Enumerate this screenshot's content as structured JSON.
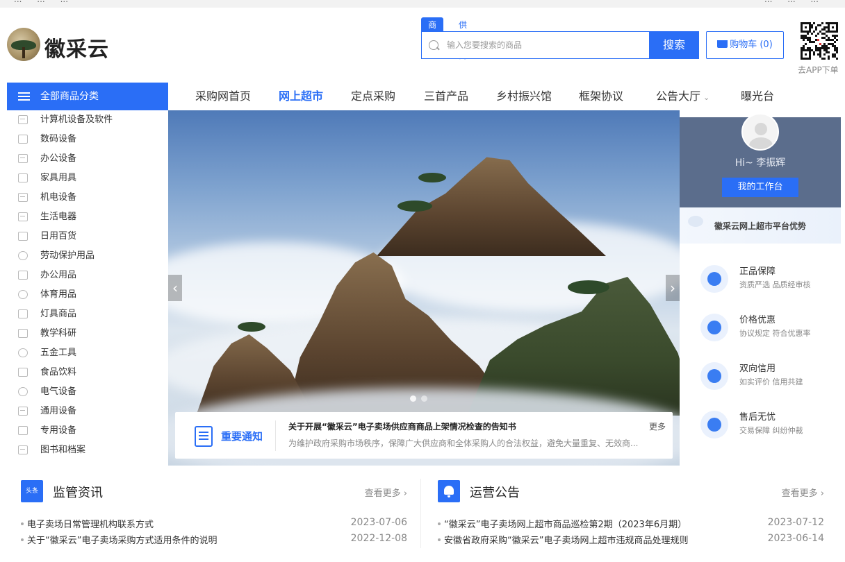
{
  "topbar": {
    "left": [
      "...",
      "...",
      "..."
    ],
    "right": [
      "...",
      "...",
      "..."
    ]
  },
  "logo": {
    "text": "徽采云"
  },
  "search": {
    "tab_goods": "商品",
    "tab_supplier": "供应商",
    "placeholder": "输入您要搜索的商品",
    "button": "搜索"
  },
  "cart": {
    "label": "购物车 (0)"
  },
  "qr": {
    "label": "去APP下单"
  },
  "category_header": "全部商品分类",
  "nav": [
    {
      "label": "采购网首页",
      "active": false
    },
    {
      "label": "网上超市",
      "active": true
    },
    {
      "label": "定点采购",
      "active": false
    },
    {
      "label": "三首产品",
      "active": false
    },
    {
      "label": "乡村振兴馆",
      "active": false
    },
    {
      "label": "框架协议",
      "active": false
    },
    {
      "label": "公告大厅",
      "active": false,
      "dropdown": true
    },
    {
      "label": "曝光台",
      "active": false
    }
  ],
  "categories": [
    {
      "label": "计算机设备及软件",
      "icon": "computer-icon"
    },
    {
      "label": "数码设备",
      "icon": "camera-icon"
    },
    {
      "label": "办公设备",
      "icon": "printer-icon"
    },
    {
      "label": "家具用具",
      "icon": "sofa-icon"
    },
    {
      "label": "机电设备",
      "icon": "machine-icon"
    },
    {
      "label": "生活电器",
      "icon": "appliance-icon"
    },
    {
      "label": "日用百货",
      "icon": "bag-icon"
    },
    {
      "label": "劳动保护用品",
      "icon": "glove-icon"
    },
    {
      "label": "办公用品",
      "icon": "stationery-icon"
    },
    {
      "label": "体育用品",
      "icon": "ball-icon"
    },
    {
      "label": "灯具商品",
      "icon": "lamp-icon"
    },
    {
      "label": "教学科研",
      "icon": "flask-icon"
    },
    {
      "label": "五金工具",
      "icon": "tool-icon"
    },
    {
      "label": "食品饮料",
      "icon": "food-icon"
    },
    {
      "label": "电气设备",
      "icon": "electric-icon"
    },
    {
      "label": "通用设备",
      "icon": "device-icon"
    },
    {
      "label": "专用设备",
      "icon": "special-device-icon"
    },
    {
      "label": "图书和档案",
      "icon": "book-icon"
    }
  ],
  "banner": {
    "prev": "‹",
    "next": "›"
  },
  "notice": {
    "tag": "重要通知",
    "title": "关于开展“徽采云”电子卖场供应商商品上架情况检查的告知书",
    "desc": "为维护政府采购市场秩序，保障广大供应商和全体采购人的合法权益，避免大量重复、无效商...",
    "more": "更多"
  },
  "user": {
    "greeting": "Hi~ 李振辉",
    "workbench": "我的工作台",
    "advantage_title": "徽采云网上超市平台优势",
    "features": [
      {
        "title": "正品保障",
        "sub": "资质严选 品质经审核",
        "icon": "shield-icon"
      },
      {
        "title": "价格优惠",
        "sub": "协议规定 符合优惠率",
        "icon": "price-tag-icon"
      },
      {
        "title": "双向信用",
        "sub": "如实评价 信用共建",
        "icon": "credit-icon"
      },
      {
        "title": "售后无忧",
        "sub": "交易保障 纠纷仲裁",
        "icon": "heart-hand-icon"
      }
    ]
  },
  "supervision": {
    "title": "监管资讯",
    "icon_text": "头条",
    "more": "查看更多",
    "items": [
      {
        "text": "电子卖场日常管理机构联系方式",
        "date": "2023-07-06"
      },
      {
        "text": "关于“徽采云”电子卖场采购方式适用条件的说明",
        "date": "2022-12-08"
      }
    ]
  },
  "operations": {
    "title": "运营公告",
    "more": "查看更多",
    "items": [
      {
        "text": "“徽采云”电子卖场网上超市商品巡检第2期（2023年6月期）",
        "date": "2023-07-12"
      },
      {
        "text": "安徽省政府采购“徽采云”电子卖场网上超市违规商品处理规则",
        "date": "2023-06-14"
      }
    ]
  },
  "colors": {
    "primary": "#2a6ef6",
    "panel": "#5b6d8c"
  }
}
